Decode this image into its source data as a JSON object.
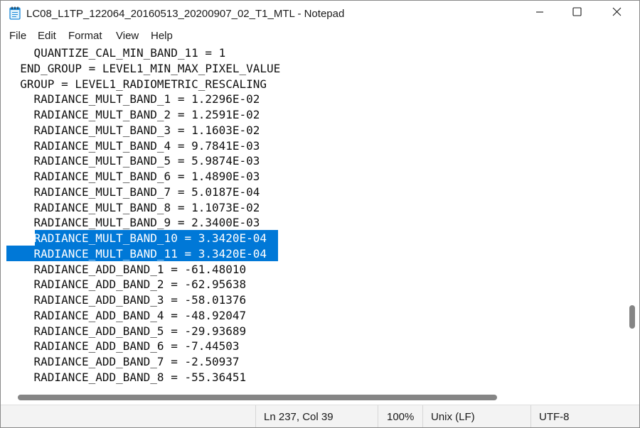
{
  "window": {
    "title": "LC08_L1TP_122064_20160513_20200907_02_T1_MTL - Notepad",
    "icons": {
      "app": "notepad-icon",
      "minimize": "minimize-icon",
      "maximize": "maximize-icon",
      "close": "close-icon"
    }
  },
  "menu": {
    "file": "File",
    "edit": "Edit",
    "format": "Format",
    "view": "View",
    "help": "Help"
  },
  "editor": {
    "lines": [
      "    QUANTIZE_CAL_MIN_BAND_11 = 1",
      "  END_GROUP = LEVEL1_MIN_MAX_PIXEL_VALUE",
      "  GROUP = LEVEL1_RADIOMETRIC_RESCALING",
      "    RADIANCE_MULT_BAND_1 = 1.2296E-02",
      "    RADIANCE_MULT_BAND_2 = 1.2591E-02",
      "    RADIANCE_MULT_BAND_3 = 1.1603E-02",
      "    RADIANCE_MULT_BAND_4 = 9.7841E-03",
      "    RADIANCE_MULT_BAND_5 = 5.9874E-03",
      "    RADIANCE_MULT_BAND_6 = 1.4890E-03",
      "    RADIANCE_MULT_BAND_7 = 5.0187E-04",
      "    RADIANCE_MULT_BAND_8 = 1.1073E-02",
      "    RADIANCE_MULT_BAND_9 = 2.3400E-03",
      "    RADIANCE_MULT_BAND_10 = 3.3420E-04",
      "    RADIANCE_MULT_BAND_11 = 3.3420E-04",
      "    RADIANCE_ADD_BAND_1 = -61.48010",
      "    RADIANCE_ADD_BAND_2 = -62.95638",
      "    RADIANCE_ADD_BAND_3 = -58.01376",
      "    RADIANCE_ADD_BAND_4 = -48.92047",
      "    RADIANCE_ADD_BAND_5 = -29.93689",
      "    RADIANCE_ADD_BAND_6 = -7.44503",
      "    RADIANCE_ADD_BAND_7 = -2.50937",
      "    RADIANCE_ADD_BAND_8 = -55.36451"
    ],
    "selection_color": "#0078d7"
  },
  "status": {
    "position": "Ln 237, Col 39",
    "zoom": "100%",
    "line_ending": "Unix (LF)",
    "encoding": "UTF-8"
  }
}
